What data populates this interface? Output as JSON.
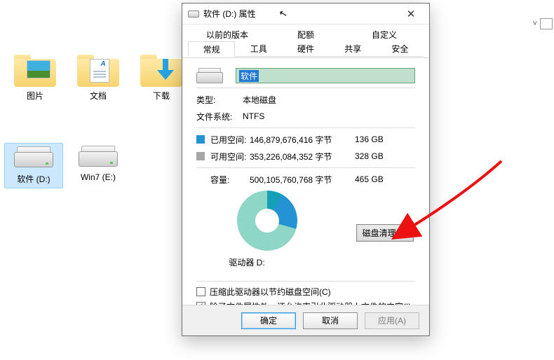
{
  "desktop": {
    "items": [
      {
        "label": "图片"
      },
      {
        "label": "文档"
      },
      {
        "label": "下载"
      },
      {
        "label": "软件 (D:)"
      },
      {
        "label": "Win7 (E:)"
      }
    ]
  },
  "right_controls": {
    "chevron": "˅",
    "helpicon": ""
  },
  "dialog": {
    "title": "软件 (D:) 属性",
    "close": "✕",
    "tabs_row2": [
      "以前的版本",
      "配额",
      "自定义"
    ],
    "tabs_row1": [
      "常规",
      "工具",
      "硬件",
      "共享",
      "安全"
    ],
    "active_tab": "常规",
    "name_value": "软件",
    "type_label": "类型:",
    "type_value": "本地磁盘",
    "fs_label": "文件系统:",
    "fs_value": "NTFS",
    "used_label": "已用空间:",
    "used_bytes": "146,879,676,416 字节",
    "used_h": "136 GB",
    "free_label": "可用空间:",
    "free_bytes": "353,226,084,352 字节",
    "free_h": "328 GB",
    "cap_label": "容量:",
    "cap_bytes": "500,105,760,768 字节",
    "cap_h": "465 GB",
    "drive_label": "驱动器 D:",
    "clean_btn": "磁盘清理(D)",
    "chk1": "压缩此驱动器以节约磁盘空间(C)",
    "chk2": "除了文件属性外，还允许索引此驱动器上文件的内容(I)",
    "chk1_checked": false,
    "chk2_checked": true,
    "ok": "确定",
    "cancel": "取消",
    "apply": "应用(A)"
  },
  "chart_data": {
    "type": "pie",
    "title": "驱动器 D:",
    "series": [
      {
        "name": "已用空间",
        "value": 136,
        "unit": "GB",
        "color": "#2393d4"
      },
      {
        "name": "可用空间",
        "value": 328,
        "unit": "GB",
        "color": "#8ed7c6"
      }
    ],
    "total": {
      "label": "容量",
      "value": 465,
      "unit": "GB"
    }
  }
}
